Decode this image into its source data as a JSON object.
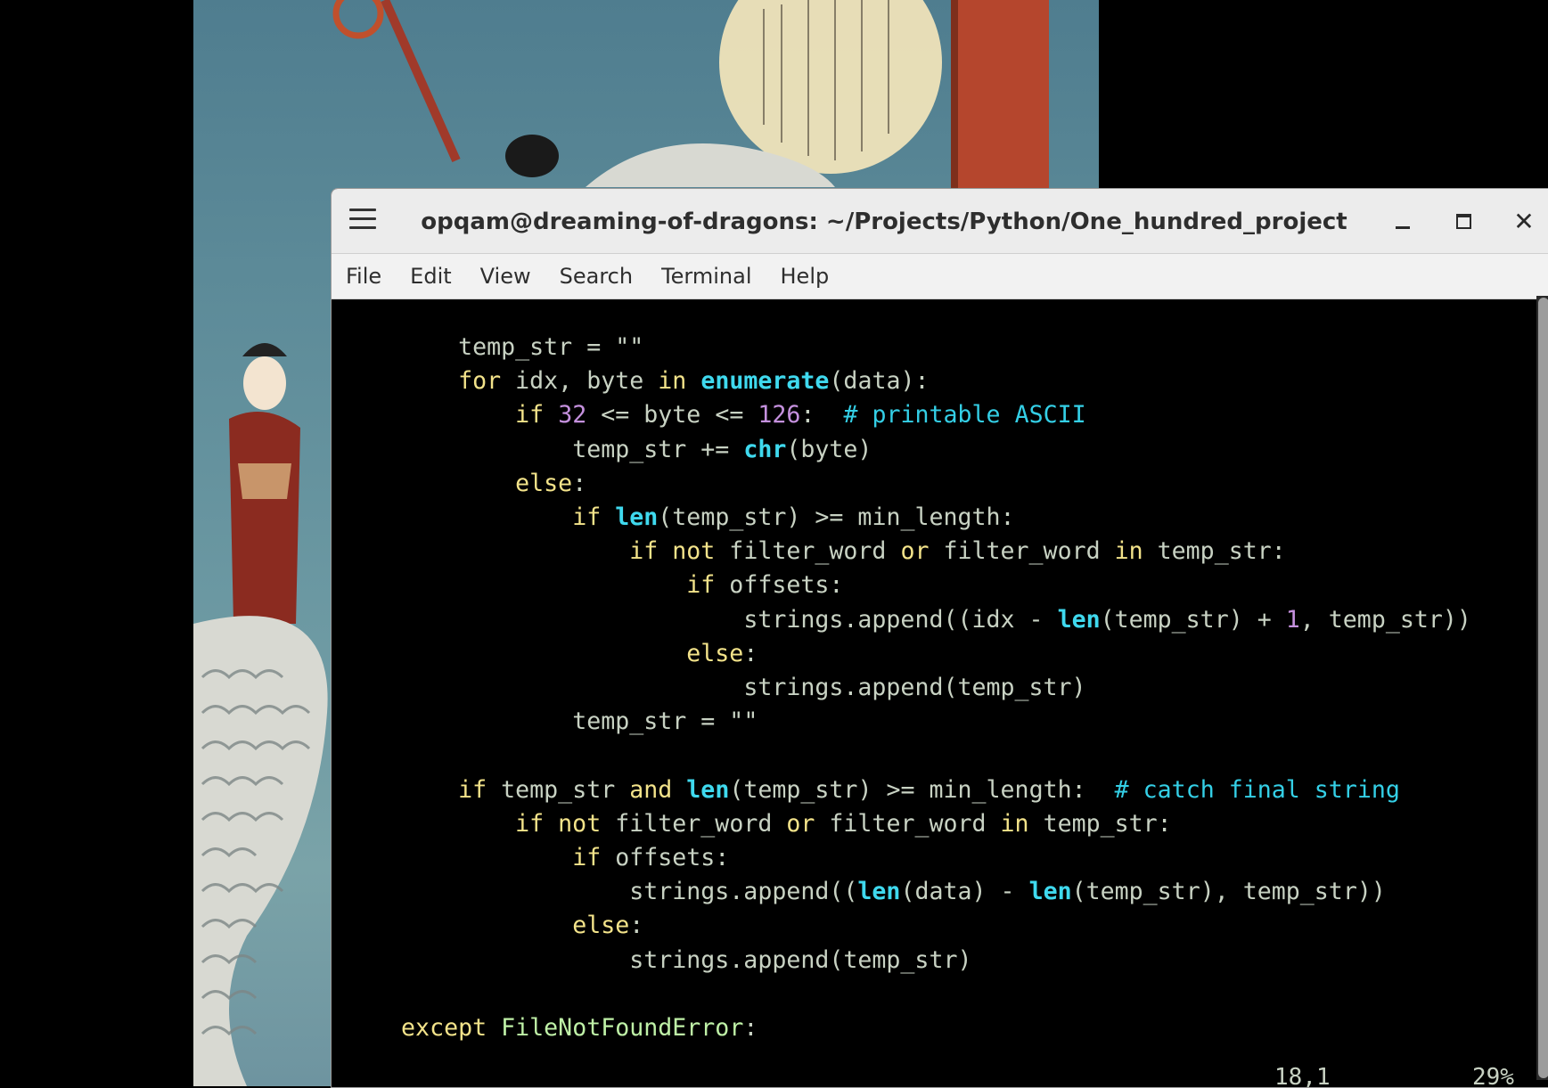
{
  "window": {
    "title": "opqam@dreaming-of-dragons: ~/Projects/Python/One_hundred_project",
    "menu_icon": "hamburger-menu-icon",
    "minimize_icon": "minimize-icon",
    "maximize_icon": "maximize-icon",
    "close_icon": "close-icon"
  },
  "menubar": {
    "items": [
      "File",
      "Edit",
      "View",
      "Search",
      "Terminal",
      "Help"
    ]
  },
  "editor": {
    "lines": [
      [
        {
          "t": "        "
        },
        {
          "c": "tx",
          "t": "temp_str = \"\""
        }
      ],
      [
        {
          "t": "        "
        },
        {
          "c": "kw",
          "t": "for"
        },
        {
          "c": "tx",
          "t": " idx, byte "
        },
        {
          "c": "kw",
          "t": "in"
        },
        {
          "t": " "
        },
        {
          "c": "bi",
          "t": "enumerate"
        },
        {
          "c": "tx",
          "t": "(data):"
        }
      ],
      [
        {
          "t": "            "
        },
        {
          "c": "kw",
          "t": "if"
        },
        {
          "t": " "
        },
        {
          "c": "nm",
          "t": "32"
        },
        {
          "c": "tx",
          "t": " <= byte <= "
        },
        {
          "c": "nm",
          "t": "126"
        },
        {
          "c": "tx",
          "t": ":  "
        },
        {
          "c": "cm",
          "t": "# printable ASCII"
        }
      ],
      [
        {
          "t": "                "
        },
        {
          "c": "tx",
          "t": "temp_str += "
        },
        {
          "c": "bi",
          "t": "chr"
        },
        {
          "c": "tx",
          "t": "(byte)"
        }
      ],
      [
        {
          "t": "            "
        },
        {
          "c": "kw",
          "t": "else"
        },
        {
          "c": "tx",
          "t": ":"
        }
      ],
      [
        {
          "t": "                "
        },
        {
          "c": "kw",
          "t": "if"
        },
        {
          "t": " "
        },
        {
          "c": "bi",
          "t": "len"
        },
        {
          "c": "tx",
          "t": "(temp_str) >= min_length:"
        }
      ],
      [
        {
          "t": "                    "
        },
        {
          "c": "kw",
          "t": "if not"
        },
        {
          "c": "tx",
          "t": " filter_word "
        },
        {
          "c": "kw",
          "t": "or"
        },
        {
          "c": "tx",
          "t": " filter_word "
        },
        {
          "c": "kw",
          "t": "in"
        },
        {
          "c": "tx",
          "t": " temp_str:"
        }
      ],
      [
        {
          "t": "                        "
        },
        {
          "c": "kw",
          "t": "if"
        },
        {
          "c": "tx",
          "t": " offsets:"
        }
      ],
      [
        {
          "t": "                            "
        },
        {
          "c": "tx",
          "t": "strings.append((idx - "
        },
        {
          "c": "bi",
          "t": "len"
        },
        {
          "c": "tx",
          "t": "(temp_str) + "
        },
        {
          "c": "nm",
          "t": "1"
        },
        {
          "c": "tx",
          "t": ", temp_str))"
        }
      ],
      [
        {
          "t": "                        "
        },
        {
          "c": "kw",
          "t": "else"
        },
        {
          "c": "tx",
          "t": ":"
        }
      ],
      [
        {
          "t": "                            "
        },
        {
          "c": "tx",
          "t": "strings.append(temp_str)"
        }
      ],
      [
        {
          "t": "                "
        },
        {
          "c": "tx",
          "t": "temp_str = \"\""
        }
      ],
      [],
      [
        {
          "t": "        "
        },
        {
          "c": "kw",
          "t": "if"
        },
        {
          "c": "tx",
          "t": " temp_str "
        },
        {
          "c": "kw",
          "t": "and"
        },
        {
          "t": " "
        },
        {
          "c": "bi",
          "t": "len"
        },
        {
          "c": "tx",
          "t": "(temp_str) >= min_length:  "
        },
        {
          "c": "cm",
          "t": "# catch final string"
        }
      ],
      [
        {
          "t": "            "
        },
        {
          "c": "kw",
          "t": "if not"
        },
        {
          "c": "tx",
          "t": " filter_word "
        },
        {
          "c": "kw",
          "t": "or"
        },
        {
          "c": "tx",
          "t": " filter_word "
        },
        {
          "c": "kw",
          "t": "in"
        },
        {
          "c": "tx",
          "t": " temp_str:"
        }
      ],
      [
        {
          "t": "                "
        },
        {
          "c": "kw",
          "t": "if"
        },
        {
          "c": "tx",
          "t": " offsets:"
        }
      ],
      [
        {
          "t": "                    "
        },
        {
          "c": "tx",
          "t": "strings.append(("
        },
        {
          "c": "bi",
          "t": "len"
        },
        {
          "c": "tx",
          "t": "(data) - "
        },
        {
          "c": "bi",
          "t": "len"
        },
        {
          "c": "tx",
          "t": "(temp_str), temp_str))"
        }
      ],
      [
        {
          "t": "                "
        },
        {
          "c": "kw",
          "t": "else"
        },
        {
          "c": "tx",
          "t": ":"
        }
      ],
      [
        {
          "t": "                    "
        },
        {
          "c": "tx",
          "t": "strings.append(temp_str)"
        }
      ],
      [],
      [
        {
          "t": "    "
        },
        {
          "c": "kw",
          "t": "except"
        },
        {
          "t": " "
        },
        {
          "c": "ex",
          "t": "FileNotFoundError"
        },
        {
          "c": "tx",
          "t": ":"
        }
      ]
    ],
    "status": {
      "position": "18,1",
      "percent": "29%"
    }
  },
  "colors": {
    "keyword": "#f3e38a",
    "builtin": "#3fd9ee",
    "number": "#c591de",
    "comment": "#34cfe6",
    "text": "#c8d2c3",
    "exception": "#bff1a7"
  }
}
